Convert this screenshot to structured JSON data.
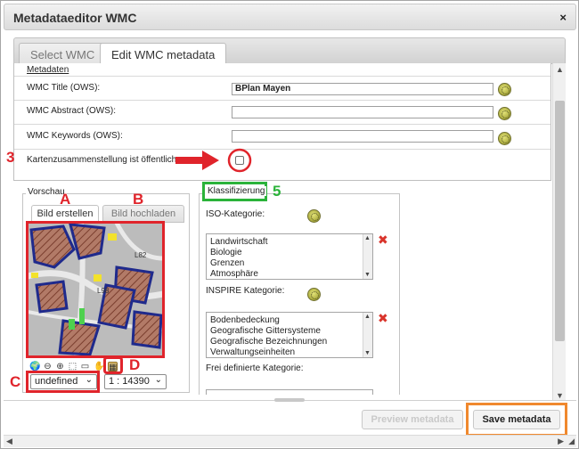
{
  "window": {
    "title": "Metadataeditor WMC",
    "close_label": "×"
  },
  "tabs": [
    {
      "label": "Select WMC",
      "active": false
    },
    {
      "label": "Edit WMC metadata",
      "active": true
    }
  ],
  "metadata": {
    "heading": "Metadaten",
    "title_label": "WMC Title (OWS):",
    "title_value": "BPlan Mayen",
    "abstract_label": "WMC Abstract (OWS):",
    "abstract_value": "",
    "keywords_label": "WMC Keywords (OWS):",
    "keywords_value": "",
    "public_label": "Kartenzusammenstellung ist öffentlich:",
    "public_checked": false
  },
  "preview": {
    "legend": "Vorschau",
    "create_tab": "Bild erstellen",
    "upload_tab": "Bild hochladen",
    "map_labels": [
      "L82",
      "L98"
    ],
    "projection": "undefined",
    "scale": "1 : 14390"
  },
  "classification": {
    "legend": "Klassifizierung",
    "iso_label": "ISO-Kategorie:",
    "iso_items": [
      "Landwirtschaft",
      "Biologie",
      "Grenzen",
      "Atmosphäre"
    ],
    "inspire_label": "INSPIRE Kategorie:",
    "inspire_items": [
      "Bodenbedeckung",
      "Geografische Gittersysteme",
      "Geografische Bezeichnungen",
      "Verwaltungseinheiten"
    ],
    "custom_label": "Frei definierte Kategorie:"
  },
  "annotations": {
    "marker_3": "3",
    "marker_5": "5",
    "marker_a": "A",
    "marker_b": "B",
    "marker_c": "C",
    "marker_d": "D"
  },
  "buttons": {
    "preview": "Preview metadata",
    "save": "Save metadata"
  },
  "colors": {
    "annotation_red": "#e0242b",
    "annotation_green": "#2bb33a",
    "annotation_orange": "#f0892e",
    "delete_x": "#d9342b"
  }
}
